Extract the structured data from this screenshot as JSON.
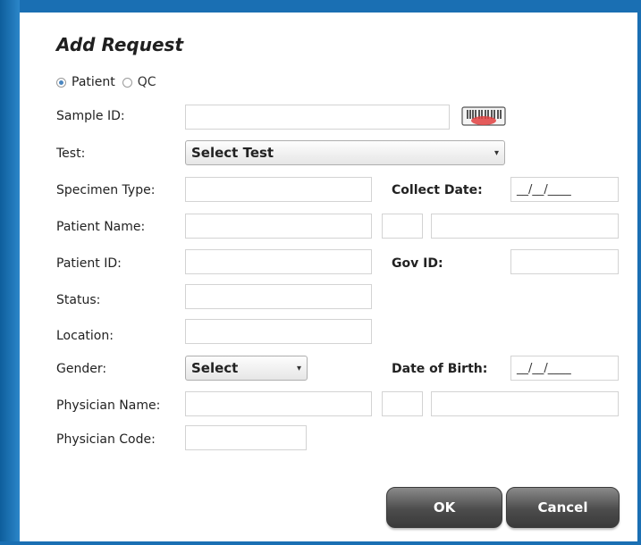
{
  "dialog": {
    "title": "Add Request",
    "radio": {
      "patient_label": "Patient",
      "qc_label": "QC",
      "selected": "Patient"
    },
    "labels": {
      "sample_id": "Sample ID:",
      "test": "Test:",
      "specimen_type": "Specimen Type:",
      "collect_date": "Collect Date:",
      "patient_name": "Patient Name:",
      "patient_id": "Patient ID:",
      "gov_id": "Gov ID:",
      "status": "Status:",
      "location": "Location:",
      "gender": "Gender:",
      "date_of_birth": "Date of Birth:",
      "physician_name": "Physician Name:",
      "physician_code": "Physician Code:"
    },
    "values": {
      "test_select": "Select Test",
      "gender_select": "Select",
      "collect_date": "__/__/____",
      "date_of_birth": "__/__/____"
    },
    "buttons": {
      "ok": "OK",
      "cancel": "Cancel"
    },
    "colors": {
      "frame": "#1a6fb3",
      "button": "#4c4c4c",
      "barcode_accent": "#e04040"
    }
  }
}
